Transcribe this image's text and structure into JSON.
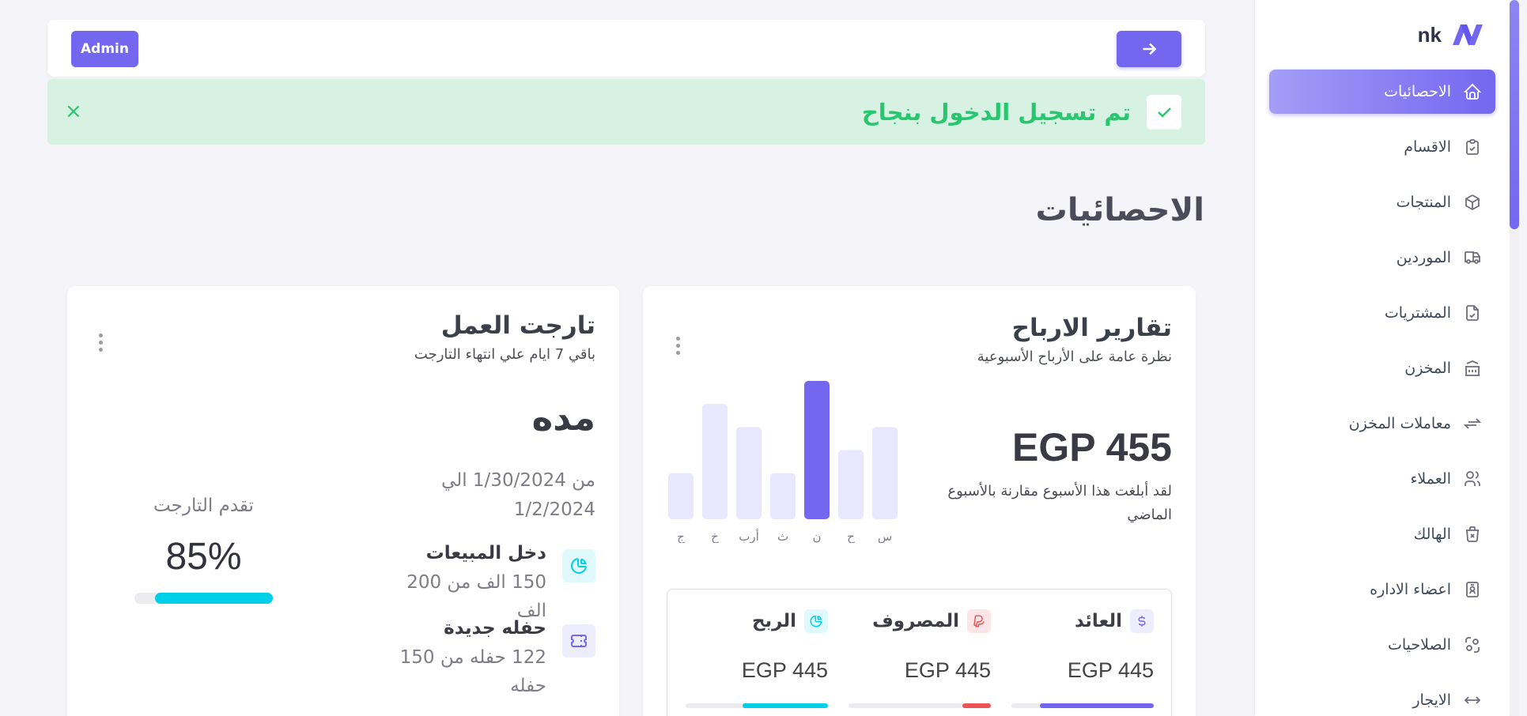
{
  "colors": {
    "primary": "#7367f0",
    "success": "#28c76f",
    "danger": "#ea5455",
    "info": "#00cfe8",
    "bar_light": "#e8e7fd"
  },
  "sidebar": {
    "brand": "nk",
    "items": [
      {
        "label": "الاحصائيات",
        "icon": "home-icon",
        "active": true
      },
      {
        "label": "الاقسام",
        "icon": "clipboard-check-icon"
      },
      {
        "label": "المنتجات",
        "icon": "box-icon"
      },
      {
        "label": "الموردين",
        "icon": "truck-icon"
      },
      {
        "label": "المشتريات",
        "icon": "file-check-icon"
      },
      {
        "label": "المخزن",
        "icon": "building-bank-icon"
      },
      {
        "label": "معاملات المخزن",
        "icon": "arrows-exchange-icon"
      },
      {
        "label": "العملاء",
        "icon": "users-icon"
      },
      {
        "label": "الهالك",
        "icon": "trash-x-icon"
      },
      {
        "label": "اعضاء الاداره",
        "icon": "id-badge-icon"
      },
      {
        "label": "الصلاحيات",
        "icon": "settings-automation-icon"
      },
      {
        "label": "الايجار",
        "icon": "arrows-horizontal-icon"
      }
    ]
  },
  "topbar": {
    "admin_label": "Admin"
  },
  "alert": {
    "message": "تم تسجيل الدخول بنجاح",
    "close": "×"
  },
  "page": {
    "title": "الاحصائيات"
  },
  "profit_card": {
    "title": "تقارير الارباح",
    "subtitle": "نظرة عامة على الأرباح الأسبوعية",
    "amount": "EGP 455",
    "compare": "لقد أبلغت هذا الأسبوع مقارنة بالأسبوع الماضي",
    "stats": [
      {
        "label": "العائد",
        "icon": "currency-dollar-icon",
        "value": "EGP 445",
        "progress": 0.8,
        "color": "#7367f0",
        "tint": "#eeedfd"
      },
      {
        "label": "المصروف",
        "icon": "paypal-icon",
        "value": "EGP 445",
        "progress": 0.2,
        "color": "#ea5455",
        "tint": "#fce5e6"
      },
      {
        "label": "الربح",
        "icon": "chart-pie-icon",
        "value": "EGP 445",
        "progress": 0.6,
        "color": "#00cfe8",
        "tint": "#e0f9fc"
      }
    ]
  },
  "chart_data": {
    "type": "bar",
    "categories": [
      "س",
      "ح",
      "ن",
      "ث",
      "أرب",
      "خ",
      "ج"
    ],
    "values": [
      40,
      30,
      60,
      20,
      40,
      50,
      20
    ],
    "highlight_index": 2,
    "grid": false
  },
  "target_card": {
    "title": "تارجت العمل",
    "subtitle": "باقي 7 ايام علي انتهاء التارجت",
    "duration_title": "مده",
    "range": "من 1/30/2024 الي 1/2/2024",
    "items": [
      {
        "title": "دخل المبيعات",
        "desc": "150 الف من 200 الف",
        "icon": "chart-pie-icon"
      },
      {
        "title": "حفله جديدة",
        "desc": "122 حفله من 150 حفله",
        "icon": "ticket-icon"
      }
    ],
    "progress_label": "تقدم التارجت",
    "progress_value": "85%",
    "progress": 0.85
  }
}
